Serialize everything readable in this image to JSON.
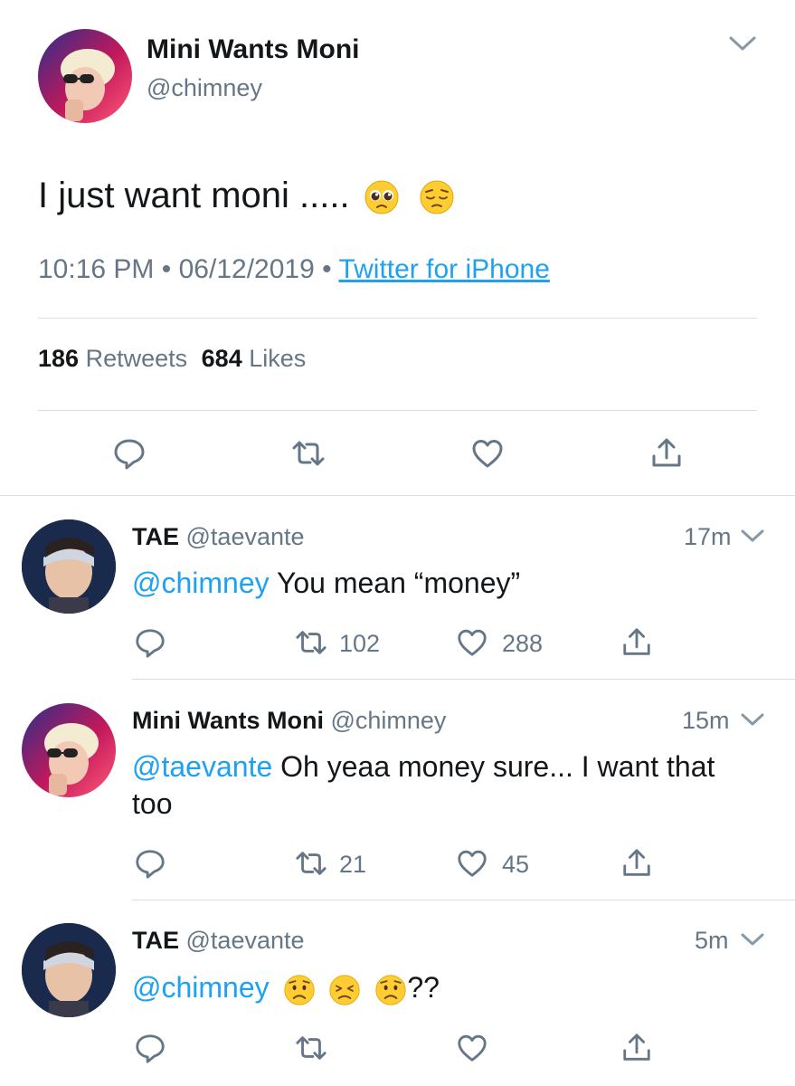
{
  "main_tweet": {
    "display_name": "Mini Wants Moni",
    "handle": "@chimney",
    "text": "I just want moni .....",
    "emojis": [
      "pleading-face",
      "pensive-face"
    ],
    "time": "10:16 PM",
    "separator": "•",
    "date": "06/12/2019",
    "source": "Twitter for iPhone",
    "retweets_count": "186",
    "retweets_label": "Retweets",
    "likes_count": "684",
    "likes_label": "Likes"
  },
  "replies": [
    {
      "display_name": "TAE",
      "handle": "@taevante",
      "time": "17m",
      "mention": "@chimney",
      "text": " You mean “money”",
      "retweets": "102",
      "likes": "288"
    },
    {
      "display_name": "Mini Wants Moni",
      "handle": "@chimney",
      "time": "15m",
      "mention": "@taevante",
      "text_line1": " Oh yeaa money sure... I want that",
      "text_line2": "too",
      "retweets": "21",
      "likes": "45"
    },
    {
      "display_name": "TAE",
      "handle": "@taevante",
      "time": "5m",
      "mention": "@chimney",
      "emojis": [
        "worried-face",
        "persevering-face",
        "worried-face"
      ],
      "text_suffix": "??",
      "retweets": "",
      "likes": ""
    }
  ],
  "colors": {
    "link_blue": "#1da1f2",
    "secondary_grey": "#657786",
    "divider": "#d9dee2"
  }
}
